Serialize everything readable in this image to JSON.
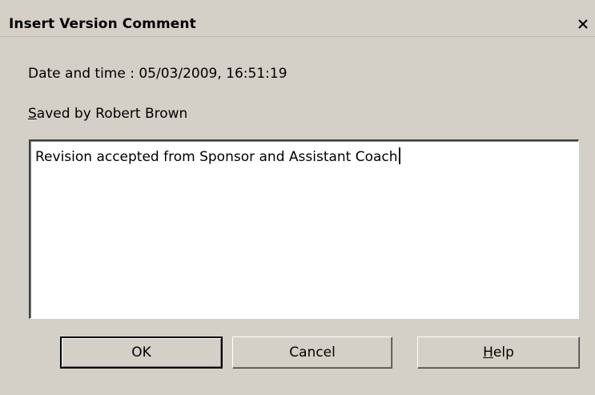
{
  "dialog": {
    "title": "Insert Version Comment",
    "close_label": "X"
  },
  "info": {
    "date_time_label": "Date and time : 05/03/2009, 16:51:19",
    "saved_by_mnemonic": "S",
    "saved_by_rest": "aved by Robert Brown"
  },
  "comment": {
    "value": "Revision accepted from Sponsor and Assistant Coach"
  },
  "buttons": {
    "ok_label": "OK",
    "cancel_label": "Cancel",
    "help_mnemonic": "H",
    "help_rest": "elp"
  },
  "colors": {
    "dialog_background": "#d4d0c8",
    "input_background": "#ffffff",
    "text": "#000000"
  },
  "icons": {
    "close": "close-icon"
  }
}
